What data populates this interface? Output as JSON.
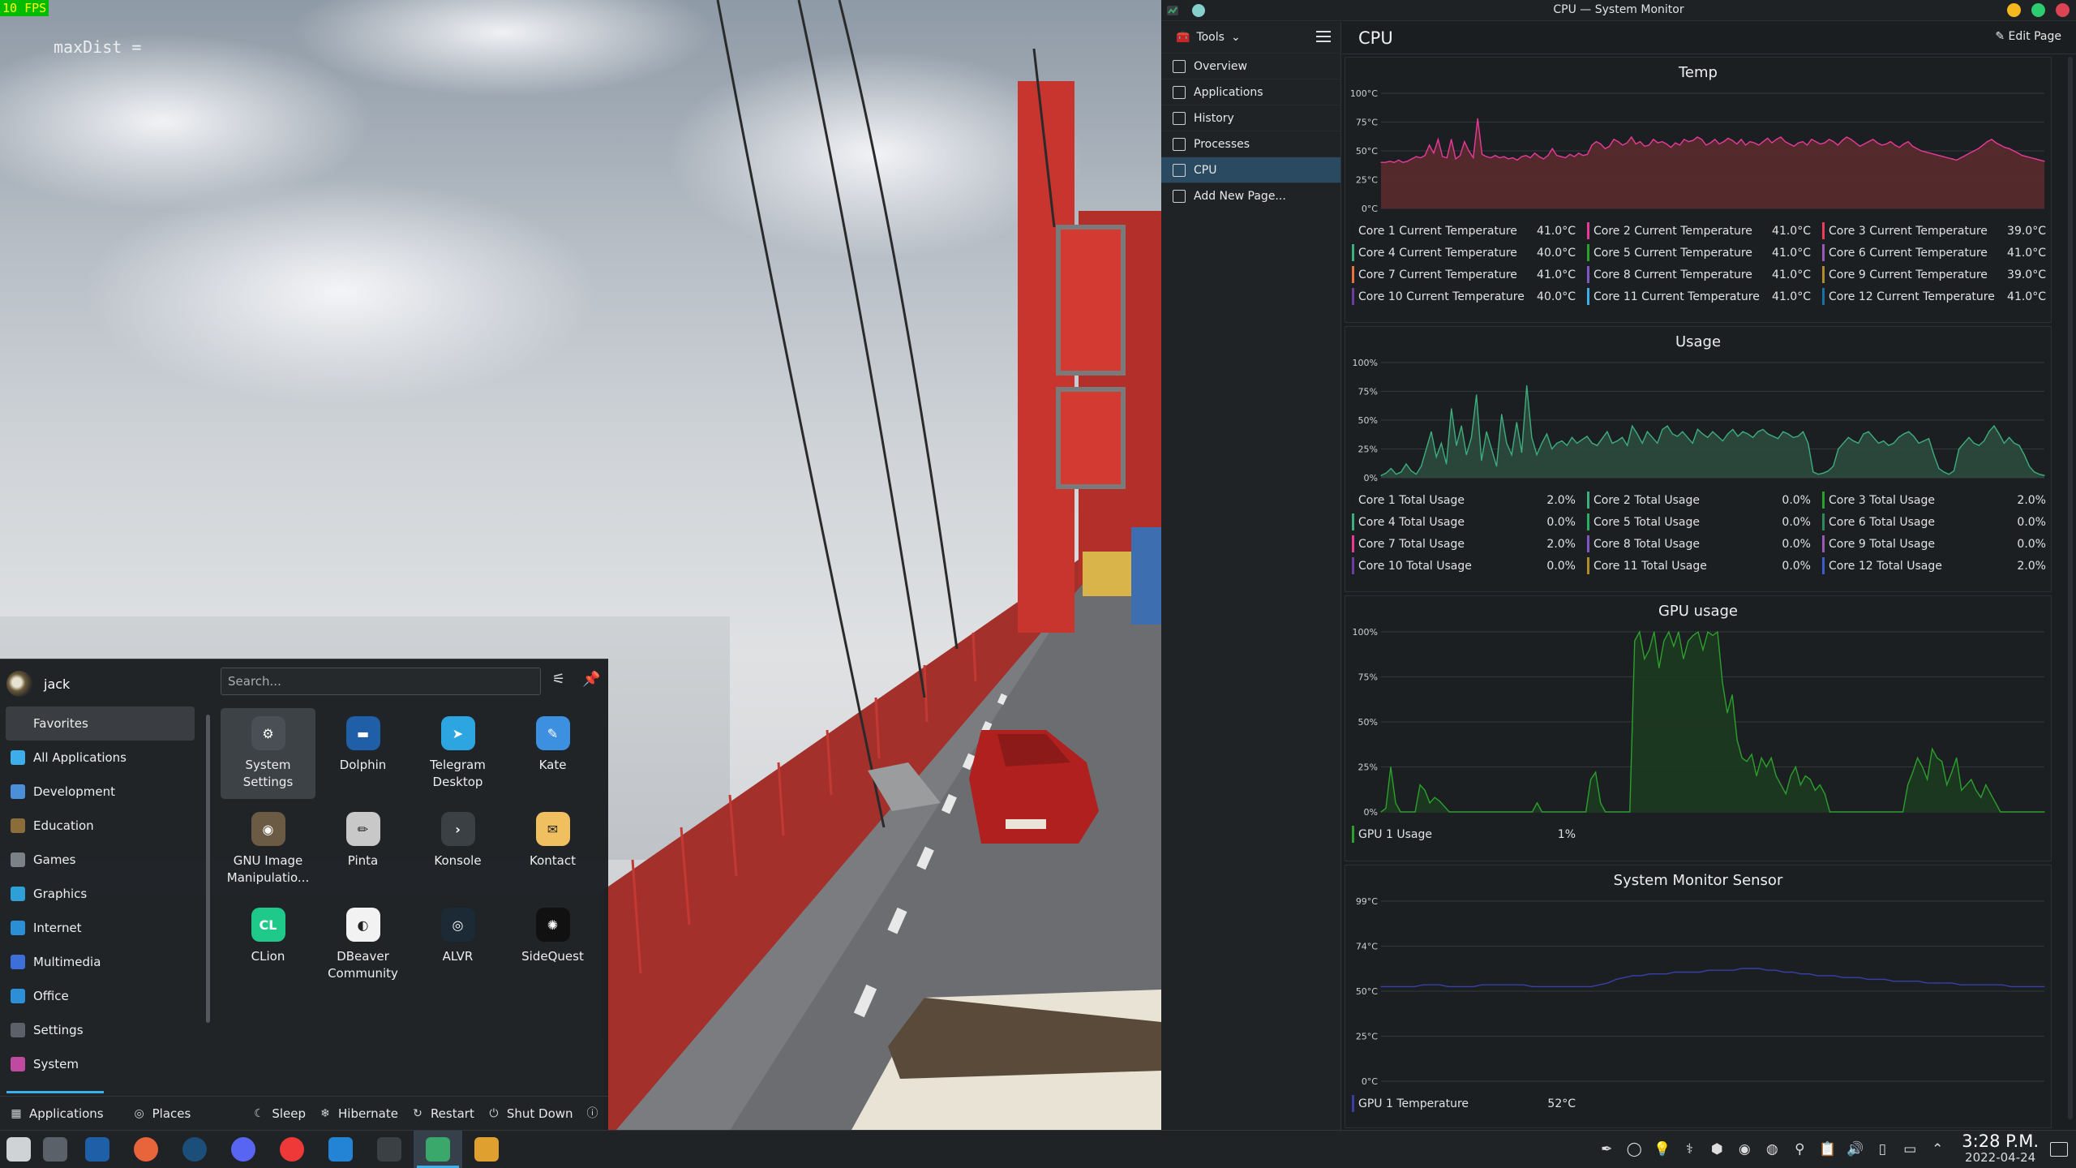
{
  "game": {
    "fps": "10 FPS",
    "debug_text": "maxDist ="
  },
  "sysmon": {
    "window_title": "CPU — System Monitor",
    "tools_label": "Tools",
    "page_title": "CPU",
    "edit_page": "Edit Page",
    "sidebar": [
      {
        "label": "Overview",
        "icon": "overview-icon"
      },
      {
        "label": "Applications",
        "icon": "applications-icon"
      },
      {
        "label": "History",
        "icon": "history-icon"
      },
      {
        "label": "Processes",
        "icon": "processes-icon"
      },
      {
        "label": "CPU",
        "icon": "cpu-icon",
        "active": true
      },
      {
        "label": "Add New Page...",
        "icon": "add-icon"
      }
    ],
    "colors": {
      "window_close": "#da4453",
      "window_max": "#2ecc71",
      "window_min": "#f5b920",
      "accent": "#3daee9",
      "selected": "#2a4a61"
    }
  },
  "chart_data": [
    {
      "type": "area",
      "title": "Temp",
      "y_ticks": [
        "100°C",
        "75°C",
        "50°C",
        "25°C",
        "0°C"
      ],
      "ylim": [
        0,
        100
      ],
      "series": [
        {
          "name": "Core 1 Current Temperature",
          "value": "41.0°C",
          "color": "#1b1e20"
        },
        {
          "name": "Core 2 Current Temperature",
          "value": "41.0°C",
          "color": "#e93a9a"
        },
        {
          "name": "Core 3 Current Temperature",
          "value": "39.0°C",
          "color": "#e93d58"
        },
        {
          "name": "Core 4 Current Temperature",
          "value": "40.0°C",
          "color": "#3dae7e"
        },
        {
          "name": "Core 5 Current Temperature",
          "value": "41.0°C",
          "color": "#2ca02c"
        },
        {
          "name": "Core 6 Current Temperature",
          "value": "41.0°C",
          "color": "#9b59b6"
        },
        {
          "name": "Core 7 Current Temperature",
          "value": "41.0°C",
          "color": "#e8743b"
        },
        {
          "name": "Core 8 Current Temperature",
          "value": "41.0°C",
          "color": "#7e57c2"
        },
        {
          "name": "Core 9 Current Temperature",
          "value": "39.0°C",
          "color": "#b08d2b"
        },
        {
          "name": "Core 10 Current Temperature",
          "value": "40.0°C",
          "color": "#6a3fa0"
        },
        {
          "name": "Core 11 Current Temperature",
          "value": "41.0°C",
          "color": "#3daee9"
        },
        {
          "name": "Core 12 Current Temperature",
          "value": "41.0°C",
          "color": "#1a6fa8"
        }
      ],
      "trace": [
        40,
        40,
        41,
        40,
        42,
        40,
        41,
        43,
        45,
        44,
        46,
        55,
        48,
        60,
        45,
        44,
        60,
        43,
        46,
        58,
        50,
        44,
        78,
        47,
        45,
        44,
        46,
        44,
        45,
        43,
        44,
        42,
        45,
        46,
        44,
        48,
        45,
        43,
        46,
        52,
        46,
        45,
        44,
        47,
        45,
        48,
        46,
        47,
        55,
        58,
        56,
        52,
        54,
        60,
        58,
        55,
        57,
        62,
        56,
        58,
        54,
        55,
        60,
        57,
        58,
        56,
        53,
        57,
        55,
        60,
        58,
        59,
        62,
        60,
        55,
        57,
        60,
        56,
        58,
        61,
        59,
        56,
        60,
        55,
        58,
        57,
        55,
        58,
        61,
        57,
        60,
        62,
        58,
        56,
        54,
        57,
        58,
        55,
        60,
        58,
        56,
        57,
        60,
        58,
        55,
        59,
        62,
        60,
        57,
        54,
        56,
        58,
        60,
        57,
        55,
        56,
        58,
        55,
        53,
        56,
        58,
        54,
        52,
        50,
        49,
        48,
        47,
        46,
        45,
        44,
        43,
        42,
        44,
        46,
        48,
        50,
        52,
        55,
        58,
        60,
        57,
        55,
        53,
        52,
        50,
        48,
        46,
        45,
        44,
        43,
        42,
        41
      ]
    },
    {
      "type": "area",
      "title": "Usage",
      "y_ticks": [
        "100%",
        "75%",
        "50%",
        "25%",
        "0%"
      ],
      "ylim": [
        0,
        100
      ],
      "series": [
        {
          "name": "Core 1 Total Usage",
          "value": "2.0%",
          "color": "#1b1e20"
        },
        {
          "name": "Core 2 Total Usage",
          "value": "0.0%",
          "color": "#3dae7e"
        },
        {
          "name": "Core 3 Total Usage",
          "value": "2.0%",
          "color": "#2ca02c"
        },
        {
          "name": "Core 4 Total Usage",
          "value": "0.0%",
          "color": "#3dae7e"
        },
        {
          "name": "Core 5 Total Usage",
          "value": "0.0%",
          "color": "#27ae60"
        },
        {
          "name": "Core 6 Total Usage",
          "value": "0.0%",
          "color": "#2e8b57"
        },
        {
          "name": "Core 7 Total Usage",
          "value": "2.0%",
          "color": "#e93a9a"
        },
        {
          "name": "Core 8 Total Usage",
          "value": "0.0%",
          "color": "#7e57c2"
        },
        {
          "name": "Core 9 Total Usage",
          "value": "0.0%",
          "color": "#9b59b6"
        },
        {
          "name": "Core 10 Total Usage",
          "value": "0.0%",
          "color": "#6a3fa0"
        },
        {
          "name": "Core 11 Total Usage",
          "value": "0.0%",
          "color": "#b08d2b"
        },
        {
          "name": "Core 12 Total Usage",
          "value": "2.0%",
          "color": "#3a5fcd"
        }
      ],
      "trace": [
        2,
        4,
        8,
        3,
        5,
        12,
        6,
        3,
        10,
        25,
        40,
        18,
        30,
        12,
        60,
        28,
        45,
        20,
        35,
        72,
        15,
        40,
        25,
        10,
        55,
        30,
        20,
        48,
        22,
        80,
        35,
        20,
        30,
        38,
        25,
        30,
        32,
        28,
        35,
        30,
        33,
        36,
        30,
        28,
        34,
        40,
        30,
        32,
        35,
        28,
        45,
        38,
        30,
        40,
        35,
        30,
        42,
        45,
        38,
        36,
        40,
        35,
        30,
        42,
        38,
        35,
        40,
        36,
        32,
        38,
        42,
        36,
        40,
        38,
        35,
        40,
        42,
        38,
        36,
        34,
        40,
        38,
        35,
        36,
        40,
        30,
        5,
        3,
        4,
        6,
        10,
        25,
        30,
        35,
        32,
        30,
        38,
        40,
        35,
        30,
        32,
        28,
        30,
        35,
        38,
        40,
        36,
        30,
        32,
        34,
        20,
        8,
        5,
        3,
        6,
        25,
        30,
        35,
        30,
        28,
        32,
        40,
        45,
        38,
        30,
        35,
        30,
        28,
        20,
        10,
        5,
        3,
        2
      ]
    },
    {
      "type": "area",
      "title": "GPU usage",
      "y_ticks": [
        "100%",
        "75%",
        "50%",
        "25%",
        "0%"
      ],
      "ylim": [
        0,
        100
      ],
      "series": [
        {
          "name": "GPU 1 Usage",
          "value": "1%",
          "color": "#2ca02c"
        }
      ],
      "trace": [
        0,
        2,
        25,
        5,
        0,
        0,
        0,
        0,
        15,
        12,
        5,
        8,
        6,
        3,
        0,
        0,
        0,
        0,
        0,
        0,
        0,
        0,
        0,
        0,
        0,
        0,
        0,
        0,
        0,
        0,
        0,
        0,
        5,
        0,
        0,
        0,
        0,
        0,
        0,
        0,
        0,
        0,
        0,
        18,
        22,
        5,
        0,
        0,
        0,
        0,
        0,
        0,
        95,
        100,
        85,
        90,
        100,
        80,
        95,
        100,
        92,
        100,
        85,
        95,
        98,
        100,
        90,
        100,
        98,
        100,
        72,
        55,
        65,
        40,
        30,
        28,
        32,
        20,
        30,
        25,
        30,
        20,
        15,
        10,
        20,
        25,
        15,
        20,
        18,
        12,
        15,
        10,
        0,
        0,
        0,
        0,
        0,
        0,
        0,
        0,
        0,
        0,
        0,
        0,
        0,
        0,
        0,
        0,
        15,
        22,
        30,
        25,
        18,
        35,
        30,
        28,
        15,
        22,
        30,
        12,
        15,
        18,
        12,
        8,
        15,
        10,
        5,
        0,
        0,
        0,
        0,
        0,
        0,
        0,
        0,
        0,
        0
      ]
    },
    {
      "type": "line",
      "title": "System Monitor Sensor",
      "y_ticks": [
        "99°C",
        "74°C",
        "50°C",
        "25°C",
        "0°C"
      ],
      "ylim": [
        0,
        99
      ],
      "series": [
        {
          "name": "GPU 1 Temperature",
          "value": "52°C",
          "color": "#3a3fa8"
        }
      ],
      "trace": [
        52,
        52,
        52,
        52,
        52,
        53,
        53,
        53,
        52,
        52,
        52,
        52,
        53,
        53,
        53,
        53,
        53,
        53,
        52,
        52,
        52,
        52,
        52,
        52,
        52,
        52,
        53,
        54,
        56,
        57,
        58,
        58,
        59,
        59,
        59,
        60,
        60,
        60,
        60,
        61,
        61,
        61,
        61,
        62,
        62,
        62,
        61,
        61,
        60,
        60,
        59,
        59,
        58,
        58,
        58,
        57,
        57,
        57,
        56,
        56,
        56,
        55,
        55,
        55,
        55,
        54,
        54,
        54,
        54,
        53,
        53,
        53,
        53,
        53,
        53,
        52,
        52,
        52,
        52,
        52
      ]
    }
  ],
  "launcher": {
    "user": "jack",
    "search_placeholder": "Search...",
    "categories": [
      {
        "label": "Favorites",
        "icon": "bookmark-icon",
        "color": "#3a3e42",
        "active": true
      },
      {
        "label": "All Applications",
        "icon": "grid-icon",
        "color": "#3daee9"
      },
      {
        "label": "Development",
        "icon": "development-icon",
        "color": "#4a8fd8"
      },
      {
        "label": "Education",
        "icon": "education-icon",
        "color": "#8a6d3b"
      },
      {
        "label": "Games",
        "icon": "gamepad-icon",
        "color": "#7a8187"
      },
      {
        "label": "Graphics",
        "icon": "graphics-icon",
        "color": "#2f9fd8"
      },
      {
        "label": "Internet",
        "icon": "globe-icon",
        "color": "#2b8fd5"
      },
      {
        "label": "Multimedia",
        "icon": "multimedia-icon",
        "color": "#3d6fd8"
      },
      {
        "label": "Office",
        "icon": "office-icon",
        "color": "#2c8fd8"
      },
      {
        "label": "Settings",
        "icon": "settings-icon",
        "color": "#5a6168"
      },
      {
        "label": "System",
        "icon": "system-icon",
        "color": "#c04aa0"
      }
    ],
    "apps": [
      {
        "label": "System\nSettings",
        "icon": "system-settings-icon",
        "color": "#4a4f55",
        "glyph": "⚙",
        "active": true
      },
      {
        "label": "Dolphin",
        "icon": "dolphin-icon",
        "color": "#1e5fa8",
        "glyph": "▬"
      },
      {
        "label": "Telegram\nDesktop",
        "icon": "telegram-icon",
        "color": "#2ca5e0",
        "glyph": "➤"
      },
      {
        "label": "Kate",
        "icon": "kate-icon",
        "color": "#3d8fe0",
        "glyph": "✎"
      },
      {
        "label": "GNU Image\nManipulatio...",
        "icon": "gimp-icon",
        "color": "#6b5a44",
        "glyph": "◉"
      },
      {
        "label": "Pinta",
        "icon": "pinta-icon",
        "color": "#c8c8c8",
        "glyph": "✏"
      },
      {
        "label": "Konsole",
        "icon": "konsole-icon",
        "color": "#3b4045",
        "glyph": "›"
      },
      {
        "label": "Kontact",
        "icon": "kontact-icon",
        "color": "#f0c060",
        "glyph": "✉"
      },
      {
        "label": "CLion",
        "icon": "clion-icon",
        "color": "#1ec98a",
        "glyph": "CL"
      },
      {
        "label": "DBeaver\nCommunity",
        "icon": "dbeaver-icon",
        "color": "#f2f2f2",
        "glyph": "◐"
      },
      {
        "label": "ALVR",
        "icon": "alvr-icon",
        "color": "#1b2a35",
        "glyph": "◎"
      },
      {
        "label": "SideQuest",
        "icon": "sidequest-icon",
        "color": "#111111",
        "glyph": "✺"
      }
    ],
    "footer": {
      "applications": "Applications",
      "places": "Places",
      "sleep": "Sleep",
      "hibernate": "Hibernate",
      "restart": "Restart",
      "shutdown": "Shut Down"
    }
  },
  "taskbar": {
    "apps": [
      {
        "icon": "app-launcher-icon",
        "color": "#cfd3d6"
      },
      {
        "icon": "pager-icon",
        "color": "#5a6168"
      },
      {
        "icon": "dolphin-icon",
        "color": "#1e5fa8"
      },
      {
        "icon": "firefox-icon",
        "color": "#e8643b"
      },
      {
        "icon": "steam-icon",
        "color": "#1b4f7a"
      },
      {
        "icon": "discord-icon",
        "color": "#5865f2"
      },
      {
        "icon": "vivaldi-icon",
        "color": "#ef3939"
      },
      {
        "icon": "vscode-icon",
        "color": "#2383d5"
      },
      {
        "icon": "konsole-icon",
        "color": "#3b4045"
      },
      {
        "icon": "system-monitor-icon",
        "color": "#3aa86a",
        "active": true
      },
      {
        "icon": "game-icon",
        "color": "#e0a030"
      }
    ],
    "tray": [
      "pen-icon",
      "circle-icon",
      "lightbulb-icon",
      "kde-connect-icon",
      "app-tray-icon",
      "obs-icon",
      "steam-tray-icon",
      "network-icon",
      "clipboard-icon",
      "volume-icon",
      "battery-icon",
      "display-icon",
      "expand-icon"
    ],
    "time": "3:28 P.M.",
    "date": "2022-04-24"
  }
}
